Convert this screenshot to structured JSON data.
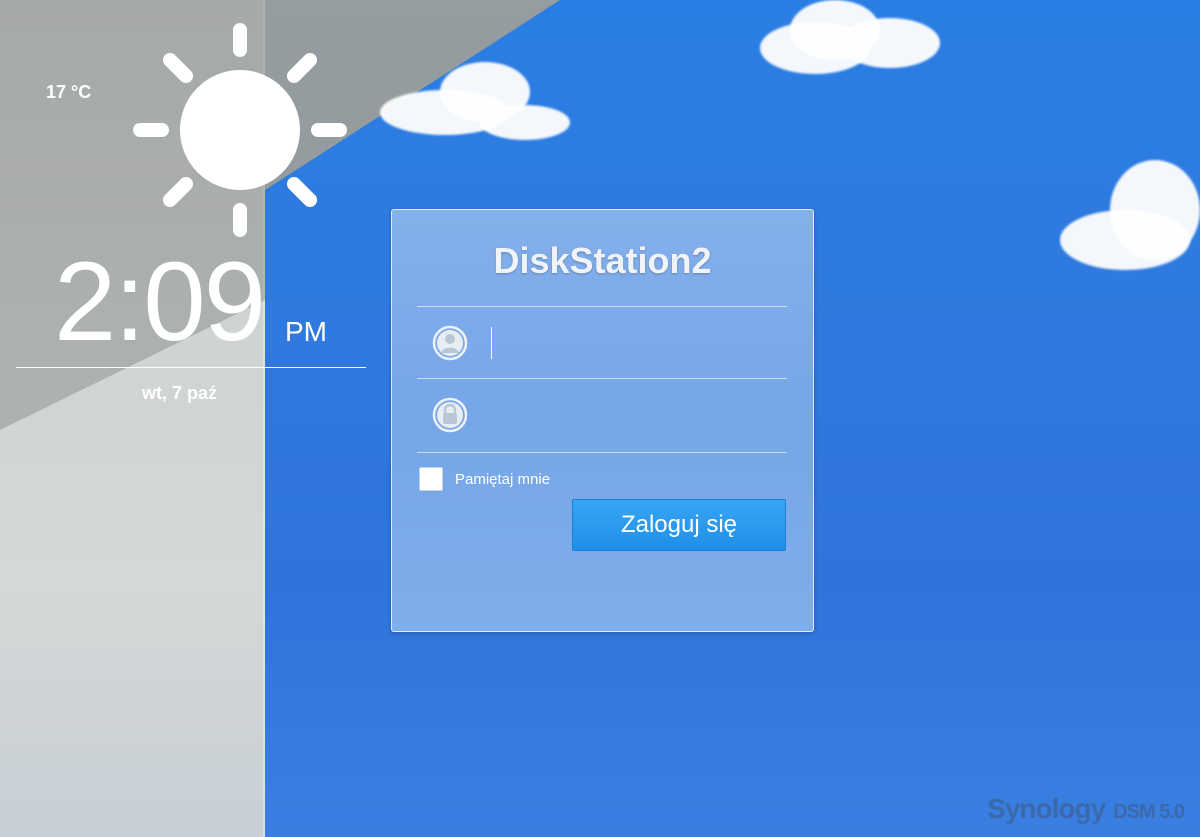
{
  "weather": {
    "temperature": "17 °C",
    "icon": "sun-icon"
  },
  "clock": {
    "time": "2:09",
    "period": "PM",
    "date": "wt, 7 paź"
  },
  "login": {
    "title": "DiskStation2",
    "username": {
      "value": "",
      "placeholder": ""
    },
    "password": {
      "value": "",
      "placeholder": ""
    },
    "remember_label": "Pamiętaj mnie",
    "remember_checked": false,
    "submit_label": "Zaloguj się"
  },
  "branding": {
    "vendor": "Synology",
    "product": "DSM 5.0"
  },
  "colors": {
    "sky": "#2f7ae0",
    "button": "#2899ee",
    "panel": "#8cb4ec"
  }
}
